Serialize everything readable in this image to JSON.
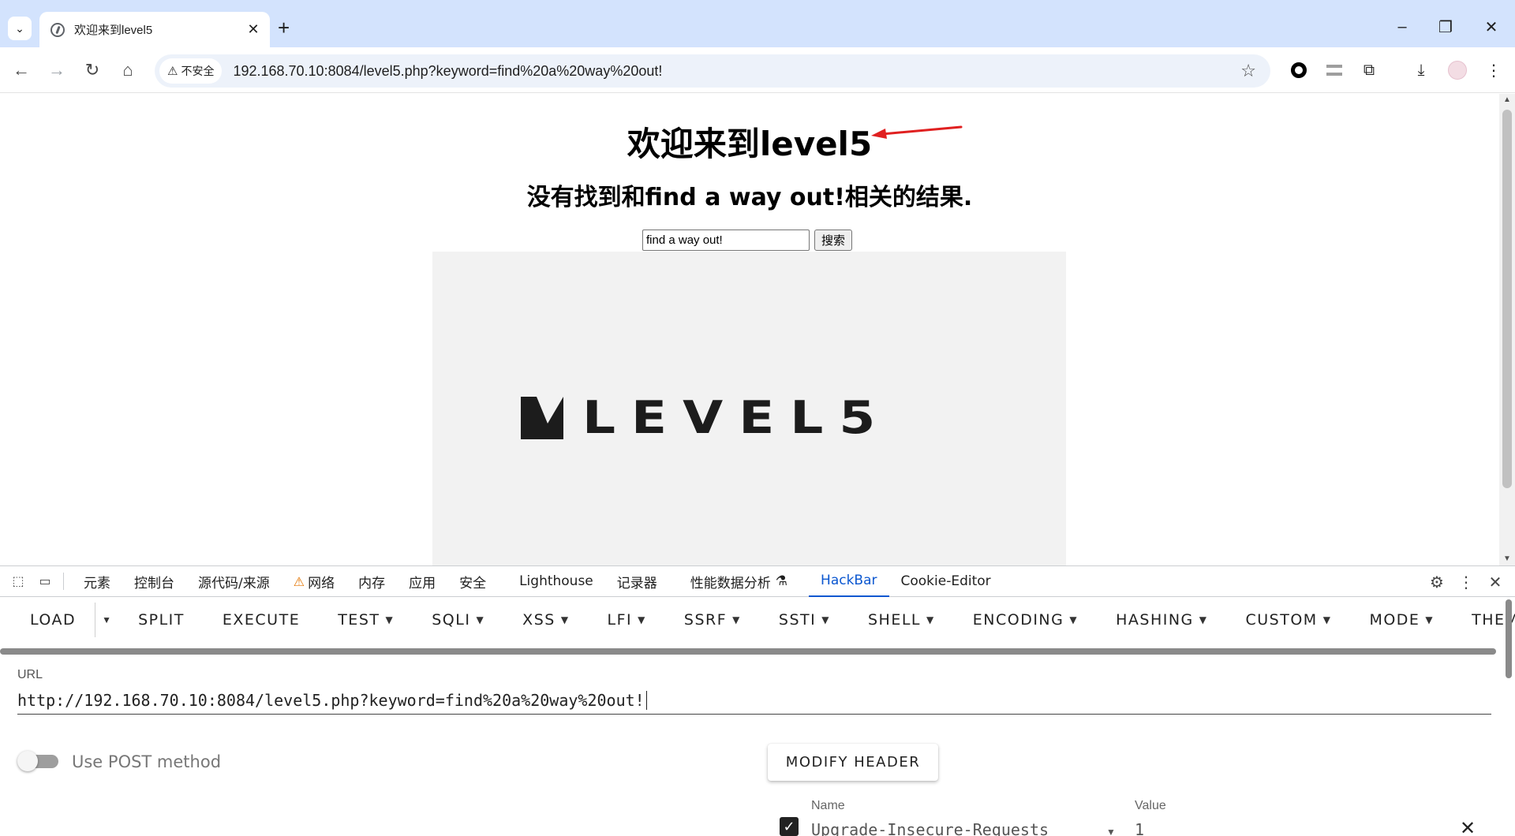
{
  "browser": {
    "tab_title": "欢迎来到level5",
    "security_label": "不安全",
    "url": "192.168.70.10:8084/level5.php?keyword=find%20a%20way%20out!"
  },
  "page": {
    "heading": "欢迎来到level5",
    "result": "没有找到和find a way out!相关的结果.",
    "search_value": "find a way out!",
    "search_button": "搜索",
    "banner_logo_text": "LEVEL5"
  },
  "devtools": {
    "tabs": [
      "元素",
      "控制台",
      "源代码/来源",
      "网络",
      "内存",
      "应用",
      "安全",
      "Lighthouse",
      "记录器",
      "性能数据分析",
      "HackBar",
      "Cookie-Editor"
    ],
    "active_tab": "HackBar"
  },
  "hackbar": {
    "menu": {
      "load": "LOAD",
      "split": "SPLIT",
      "execute": "EXECUTE",
      "test": "TEST",
      "sqli": "SQLI",
      "xss": "XSS",
      "lfi": "LFI",
      "ssrf": "SSRF",
      "ssti": "SSTI",
      "shell": "SHELL",
      "encoding": "ENCODING",
      "hashing": "HASHING",
      "custom": "CUSTOM",
      "mode": "MODE",
      "theme": "THEME"
    },
    "url_label": "URL",
    "url_value": "http://192.168.70.10:8084/level5.php?keyword=find%20a%20way%20out!",
    "post_toggle_label": "Use POST method",
    "post_toggle_on": false,
    "modify_header_button": "MODIFY HEADER",
    "header_name_label": "Name",
    "header_value_label": "Value",
    "header_row": {
      "checked": true,
      "name": "Upgrade-Insecure-Requests",
      "value": "1"
    }
  },
  "colors": {
    "tabstrip": "#d3e3fd",
    "active_devtools_tab": "#0b57d0",
    "banner_bg": "#f2f2f2",
    "arrow": "#e02020"
  }
}
